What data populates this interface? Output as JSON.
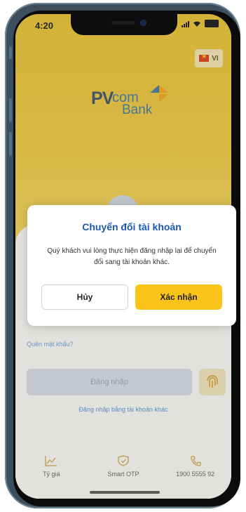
{
  "status_bar": {
    "time": "4:20"
  },
  "language": {
    "code": "VI"
  },
  "logo": {
    "pv": "PV",
    "com": "com",
    "bank": "Bank"
  },
  "login": {
    "forgot_password": "Quên mật khẩu?",
    "login_button": "Đăng nhập",
    "other_account_link": "Đăng nhập bằng tài khoản khác"
  },
  "bottom_nav": [
    {
      "label": "Tỷ giá",
      "icon": "chart-icon"
    },
    {
      "label": "Smart OTP",
      "icon": "shield-check-icon"
    },
    {
      "label": "1900 5555 92",
      "icon": "phone-icon"
    }
  ],
  "dialog": {
    "title": "Chuyển đổi tài khoản",
    "message": "Quý khách vui lòng thực hiện đăng nhập lại để chuyển đổi sang tài khoản khác.",
    "cancel_label": "Hủy",
    "confirm_label": "Xác nhận"
  },
  "colors": {
    "brand_yellow": "#fcc419",
    "brand_blue": "#1a58b3",
    "link_blue": "#1d6fbf"
  }
}
